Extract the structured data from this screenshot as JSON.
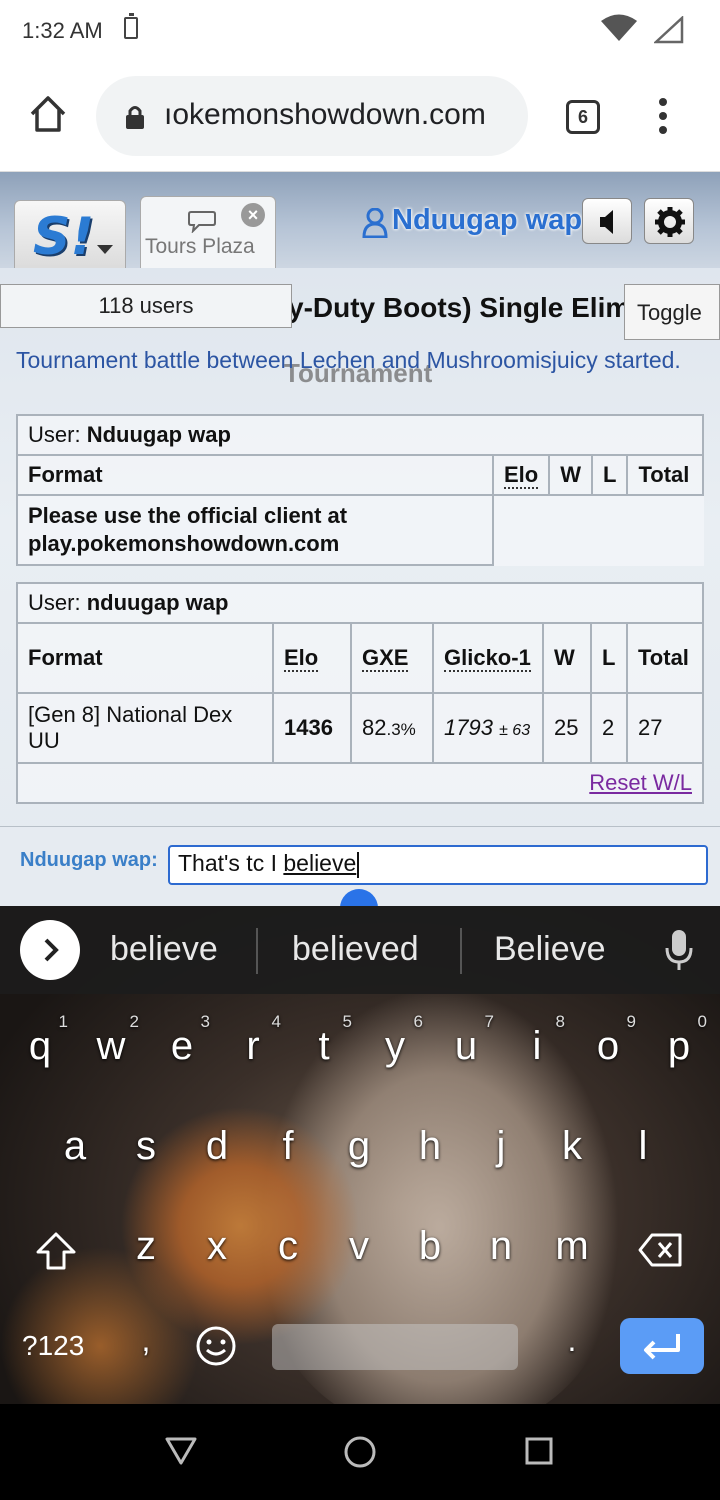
{
  "status_bar": {
    "time": "1:32 AM"
  },
  "browser": {
    "url": "ıokemonshowdown.com",
    "tab_count": "6"
  },
  "header": {
    "room_tab_label": "Tours Plaza",
    "username": "Nduugap wap"
  },
  "room": {
    "title": "y-Duty Boots) Single Elim",
    "subtitle": "Tournament",
    "users_count": "118 users",
    "toggle_label": "Toggle",
    "battle_message": "Tournament battle between Lechen and Mushroomisjuicy started."
  },
  "table1": {
    "user_label": "User: ",
    "user_name": "Nduugap wap",
    "headers": [
      "Format",
      "Elo",
      "W",
      "L",
      "Total"
    ],
    "notice": "Please use the official client at play.pokemonshowdown.com"
  },
  "table2": {
    "user_label": "User: ",
    "user_name": "nduugap wap",
    "headers": [
      "Format",
      "Elo",
      "GXE",
      "Glicko-1",
      "W",
      "L",
      "Total"
    ],
    "row": {
      "format": "[Gen 8] National Dex UU",
      "elo": "1436",
      "gxe": "82",
      "gxe_decimal": ".3%",
      "glicko": "1793",
      "glicko_dev": "± 63",
      "w": "25",
      "l": "2",
      "total": "27"
    },
    "reset_label": "Reset W/L"
  },
  "chat": {
    "user_label": "Nduugap wap:",
    "text_before": "That's tc I ",
    "text_underlined": "believe"
  },
  "keyboard": {
    "suggestions": [
      "believe",
      "believed",
      "Believe"
    ],
    "row1": [
      "q",
      "w",
      "e",
      "r",
      "t",
      "y",
      "u",
      "i",
      "o",
      "p"
    ],
    "row1_nums": [
      "1",
      "2",
      "3",
      "4",
      "5",
      "6",
      "7",
      "8",
      "9",
      "0"
    ],
    "row2": [
      "a",
      "s",
      "d",
      "f",
      "g",
      "h",
      "j",
      "k",
      "l"
    ],
    "row3": [
      "z",
      "x",
      "c",
      "v",
      "b",
      "n",
      "m"
    ],
    "symbols_label": "?123",
    "comma": ",",
    "period": "."
  }
}
